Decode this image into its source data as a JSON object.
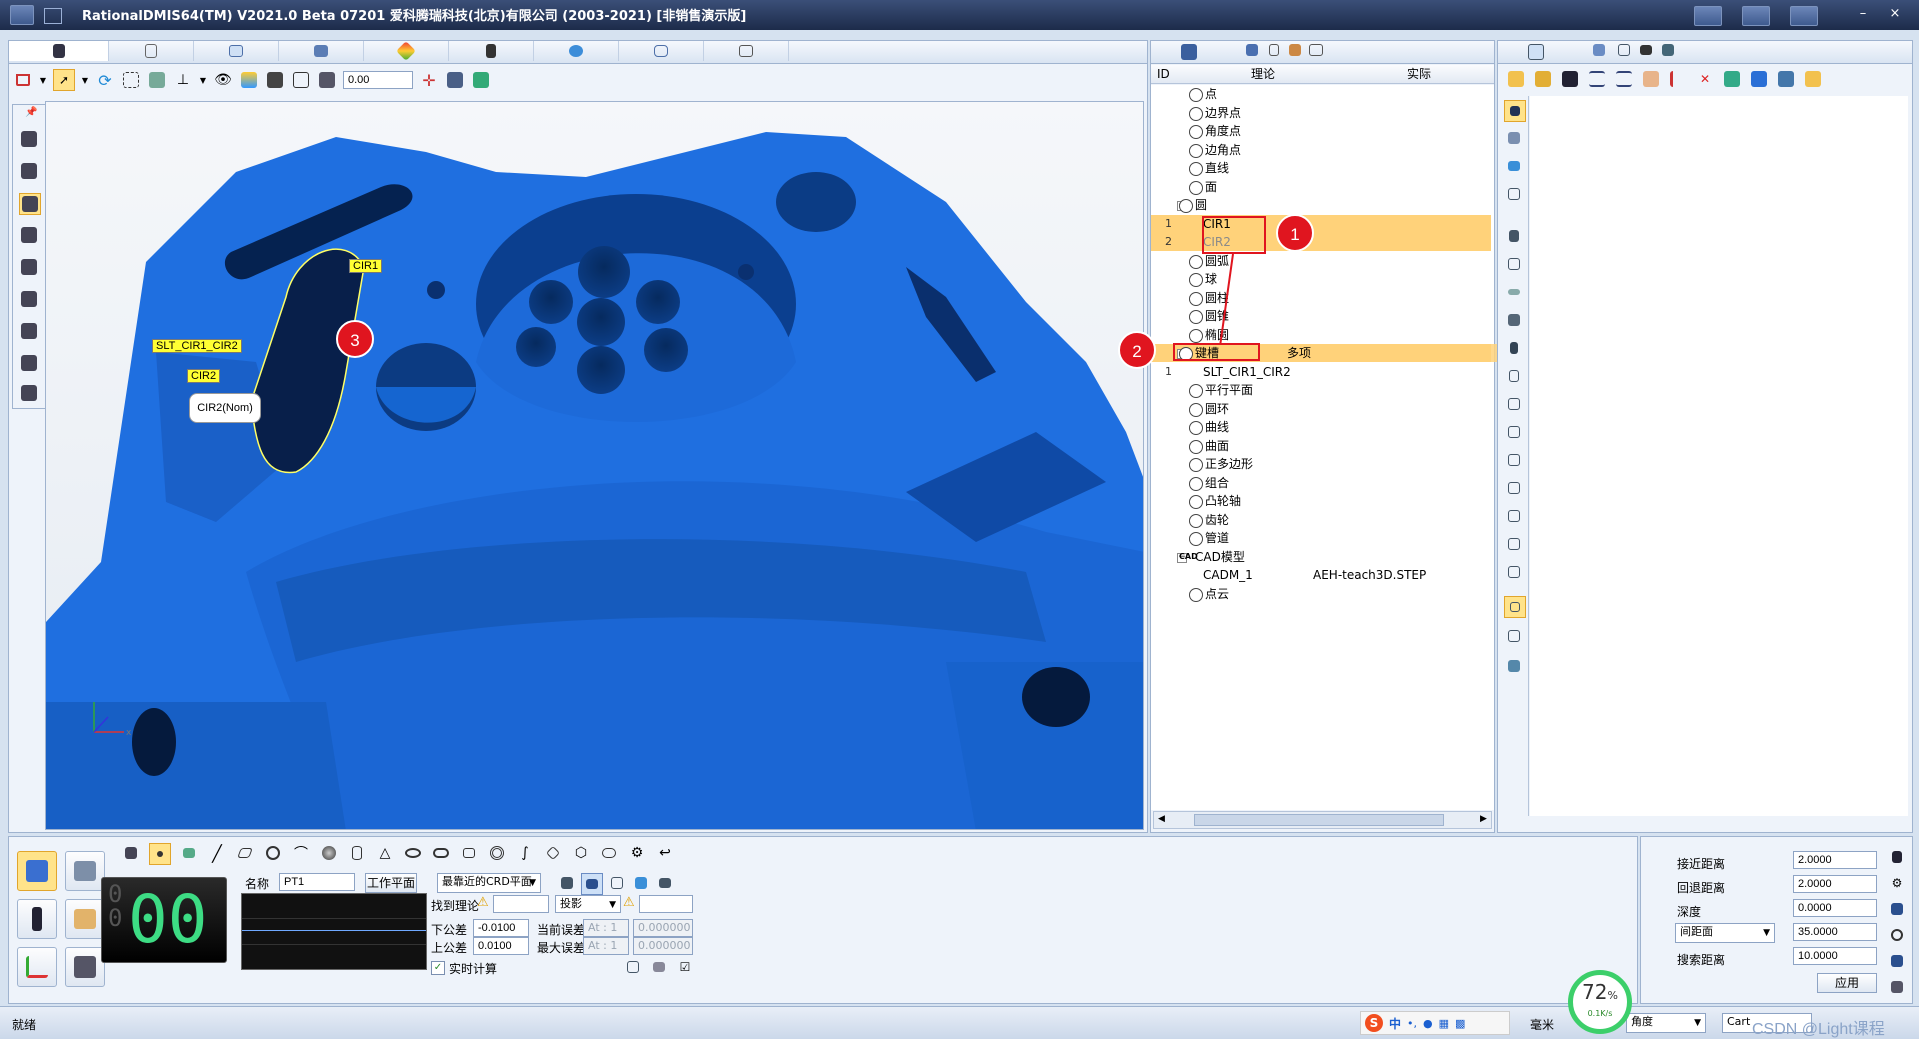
{
  "window": {
    "title": "RationalDMIS64(TM) V2021.0 Beta 07201   爱科腾瑞科技(北京)有限公司 (2003-2021) [非销售演示版]"
  },
  "toolbar": {
    "zoom_value": "0.00"
  },
  "viewport": {
    "labels": {
      "cir1": "CIR1",
      "slt": "SLT_CIR1_CIR2",
      "cir2": "CIR2",
      "cir2_tooltip": "CIR2(Nom)"
    },
    "badges": {
      "b1": "1",
      "b2": "2",
      "b3": "3"
    },
    "axis_x": "x"
  },
  "tree": {
    "headers": {
      "id": "ID",
      "nominal": "理论",
      "actual": "实际"
    },
    "rows": [
      {
        "id": "",
        "label": "点",
        "actual": ""
      },
      {
        "id": "",
        "label": "边界点",
        "actual": ""
      },
      {
        "id": "",
        "label": "角度点",
        "actual": ""
      },
      {
        "id": "",
        "label": "边角点",
        "actual": ""
      },
      {
        "id": "",
        "label": "直线",
        "actual": ""
      },
      {
        "id": "",
        "label": "面",
        "actual": ""
      },
      {
        "id": "",
        "label": "圆",
        "actual": ""
      },
      {
        "id": "1",
        "label": "CIR1",
        "actual": ""
      },
      {
        "id": "2",
        "label": "CIR2",
        "actual": ""
      },
      {
        "id": "",
        "label": "圆弧",
        "actual": ""
      },
      {
        "id": "",
        "label": "球",
        "actual": ""
      },
      {
        "id": "",
        "label": "圆柱",
        "actual": ""
      },
      {
        "id": "",
        "label": "圆锥",
        "actual": ""
      },
      {
        "id": "",
        "label": "椭圆",
        "actual": ""
      },
      {
        "id": "",
        "label": "键槽",
        "actual": "多项"
      },
      {
        "id": "1",
        "label": "SLT_CIR1_CIR2",
        "actual": ""
      },
      {
        "id": "",
        "label": "平行平面",
        "actual": ""
      },
      {
        "id": "",
        "label": "圆环",
        "actual": ""
      },
      {
        "id": "",
        "label": "曲线",
        "actual": ""
      },
      {
        "id": "",
        "label": "曲面",
        "actual": ""
      },
      {
        "id": "",
        "label": "正多边形",
        "actual": ""
      },
      {
        "id": "",
        "label": "组合",
        "actual": ""
      },
      {
        "id": "",
        "label": "凸轮轴",
        "actual": ""
      },
      {
        "id": "",
        "label": "齿轮",
        "actual": ""
      },
      {
        "id": "",
        "label": "管道",
        "actual": ""
      },
      {
        "id": "",
        "label": "CAD模型",
        "actual": ""
      },
      {
        "id": "",
        "label": "CADM_1",
        "actual": "AEH-teach3D.STEP"
      },
      {
        "id": "",
        "label": "点云",
        "actual": ""
      }
    ],
    "cad_icon_text": "CAD"
  },
  "bottom": {
    "counter_small": "0\n0",
    "counter_big": "00",
    "name_label": "名称",
    "name_value": "PT1",
    "workplane_button": "工作平面",
    "crd_select": "最靠近的CRD平面",
    "find_nominal_label": "找到理论",
    "projection_select": "投影",
    "lower_tol_label": "下公差",
    "lower_tol_value": "-0.0100",
    "upper_tol_label": "上公差",
    "upper_tol_value": "0.0100",
    "current_err_label": "当前误差",
    "max_err_label": "最大误差",
    "at1": "At : 1",
    "at2": "At : 1",
    "err1": "0.000000",
    "err2": "0.000000",
    "realtime_label": "实时计算"
  },
  "approach": {
    "approach_label": "接近距离",
    "approach_value": "2.0000",
    "retract_label": "回退距离",
    "retract_value": "2.0000",
    "depth_label": "深度",
    "depth_value": "0.0000",
    "spacing_select": "间距面",
    "spacing_value": "35.0000",
    "search_label": "搜索距离",
    "search_value": "10.0000",
    "apply_button": "应用"
  },
  "status": {
    "ready": "就绪",
    "unit": "毫米",
    "angle_select": "角度",
    "coord_select": "Cart",
    "perf_percent": "72",
    "perf_pct_sign": "%",
    "perf_speed": "0.1K/s",
    "watermark": "CSDN @Light课程",
    "ime_ch": "中"
  },
  "colors": {
    "model_blue": "#1f6fe0",
    "highlight": "#ffd27a",
    "badge_red": "#e0151f"
  }
}
